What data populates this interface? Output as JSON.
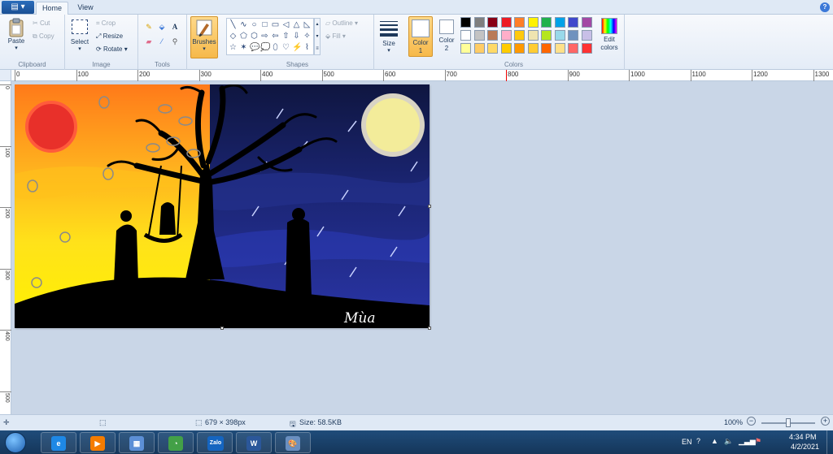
{
  "menu": {
    "file_icon": "paint-menu-icon",
    "tabs": [
      {
        "label": "Home"
      },
      {
        "label": "View"
      }
    ],
    "help_label": "?"
  },
  "ribbon": {
    "clipboard": {
      "group_label": "Clipboard",
      "paste": "Paste",
      "cut": "Cut",
      "copy": "Copy"
    },
    "image": {
      "group_label": "Image",
      "select": "Select",
      "crop": "Crop",
      "resize": "Resize",
      "rotate": "Rotate"
    },
    "tools": {
      "group_label": "Tools",
      "items": [
        "pencil-icon",
        "fill-icon",
        "text-icon",
        "eraser-icon",
        "color-picker-icon",
        "magnifier-icon"
      ]
    },
    "brushes": {
      "label": "Brushes"
    },
    "shapes": {
      "group_label": "Shapes",
      "outline": "Outline",
      "fill": "Fill",
      "glyphs": [
        "╲",
        "∿",
        "○",
        "□",
        "▭",
        "◁",
        "△",
        "◺",
        "◇",
        "⬠",
        "⬡",
        "⇨",
        "⇦",
        "⇧",
        "⇩",
        "✧",
        "☆",
        "✶",
        "💬",
        "💭",
        "⬯",
        "♡",
        "⚡",
        "⌇"
      ]
    },
    "size": {
      "label": "Size"
    },
    "colors": {
      "group_label": "Colors",
      "color1": "Color\n1",
      "color1_label": "Color",
      "color1_num": "1",
      "color2_label": "Color",
      "color2_num": "2",
      "edit_label": "Edit",
      "edit_label2": "colors",
      "color1_value": "#ffffff",
      "color2_value": "#ffffff",
      "row1": [
        "#000000",
        "#7f7f7f",
        "#880015",
        "#ed1c24",
        "#ff7f27",
        "#fff200",
        "#22b14c",
        "#00a2e8",
        "#3f48cc",
        "#a349a4"
      ],
      "row2": [
        "#ffffff",
        "#c3c3c3",
        "#b97a57",
        "#ffaec9",
        "#ffc90e",
        "#efe4b0",
        "#b5e61d",
        "#99d9ea",
        "#7092be",
        "#c8bfe7"
      ],
      "row3": [
        "#ffff99",
        "#ffcc66",
        "#ffd966",
        "#ffcc00",
        "#ff9900",
        "#ffcc33",
        "#ff6600",
        "#ffe08a",
        "#ff6666",
        "#ff3333"
      ],
      "row4": [
        "#ffffff",
        "#ffffff",
        "#ffffff",
        "#ffffff",
        "#ffffff",
        "#ffffff",
        "#ffffff",
        "#ffffff",
        "#ffffff",
        "#ffffff"
      ]
    }
  },
  "ruler": {
    "h_labels": [
      "0",
      "100",
      "200",
      "300",
      "400",
      "500",
      "600",
      "700",
      "800",
      "900",
      "1000",
      "1100",
      "1200",
      "1300"
    ],
    "v_labels": [
      "0",
      "100",
      "200",
      "300",
      "400",
      "500"
    ]
  },
  "canvas": {
    "signature": "Mùa",
    "sky_left": "#ff8a1f",
    "sky_right": "#131c55",
    "sun_color": "#e8302a",
    "moon_color": "#f3ec9a"
  },
  "status": {
    "dimensions": "679 × 398px",
    "size": "Size: 58.5KB",
    "zoom": "100%"
  },
  "taskbar": {
    "apps": [
      {
        "name": "internet-explorer-icon",
        "glyph": "e",
        "color": "#1e88e5"
      },
      {
        "name": "media-player-icon",
        "glyph": "▶",
        "color": "#f57c00"
      },
      {
        "name": "file-manager-icon",
        "glyph": "▦",
        "color": "#5c8fd6"
      },
      {
        "name": "coccoc-browser-icon",
        "glyph": "◔",
        "color": "#43a047"
      },
      {
        "name": "zalo-icon",
        "glyph": "Zalo",
        "color": "#1565c0"
      },
      {
        "name": "word-icon",
        "glyph": "W",
        "color": "#2b579a"
      },
      {
        "name": "paint-icon",
        "glyph": "🎨",
        "color": "#6a8fc0"
      }
    ],
    "lang": "EN",
    "time": "4:34 PM",
    "date": "4/2/2021"
  }
}
